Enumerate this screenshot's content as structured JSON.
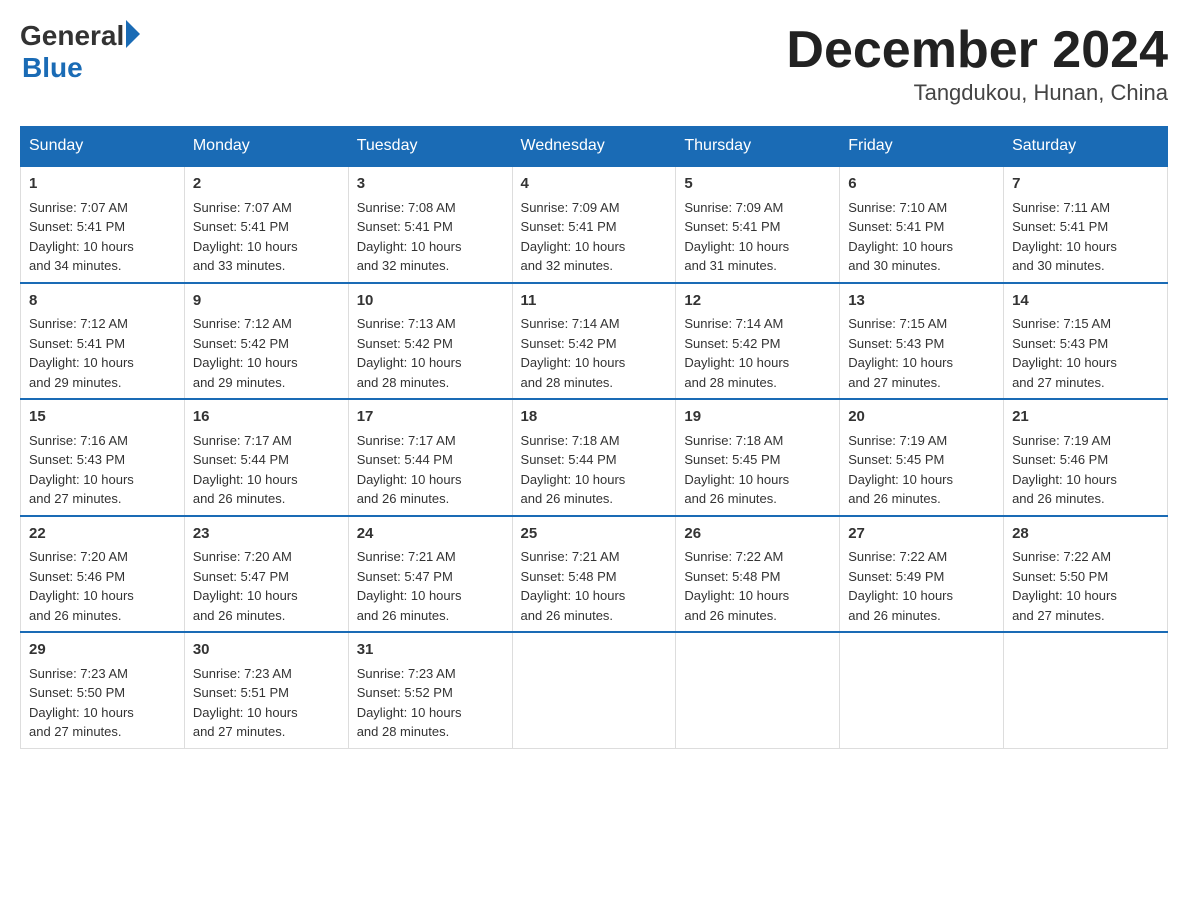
{
  "header": {
    "logo_general": "General",
    "logo_blue": "Blue",
    "month_title": "December 2024",
    "subtitle": "Tangdukou, Hunan, China"
  },
  "days_of_week": [
    "Sunday",
    "Monday",
    "Tuesday",
    "Wednesday",
    "Thursday",
    "Friday",
    "Saturday"
  ],
  "weeks": [
    [
      {
        "num": "1",
        "sunrise": "7:07 AM",
        "sunset": "5:41 PM",
        "daylight": "10 hours and 34 minutes."
      },
      {
        "num": "2",
        "sunrise": "7:07 AM",
        "sunset": "5:41 PM",
        "daylight": "10 hours and 33 minutes."
      },
      {
        "num": "3",
        "sunrise": "7:08 AM",
        "sunset": "5:41 PM",
        "daylight": "10 hours and 32 minutes."
      },
      {
        "num": "4",
        "sunrise": "7:09 AM",
        "sunset": "5:41 PM",
        "daylight": "10 hours and 32 minutes."
      },
      {
        "num": "5",
        "sunrise": "7:09 AM",
        "sunset": "5:41 PM",
        "daylight": "10 hours and 31 minutes."
      },
      {
        "num": "6",
        "sunrise": "7:10 AM",
        "sunset": "5:41 PM",
        "daylight": "10 hours and 30 minutes."
      },
      {
        "num": "7",
        "sunrise": "7:11 AM",
        "sunset": "5:41 PM",
        "daylight": "10 hours and 30 minutes."
      }
    ],
    [
      {
        "num": "8",
        "sunrise": "7:12 AM",
        "sunset": "5:41 PM",
        "daylight": "10 hours and 29 minutes."
      },
      {
        "num": "9",
        "sunrise": "7:12 AM",
        "sunset": "5:42 PM",
        "daylight": "10 hours and 29 minutes."
      },
      {
        "num": "10",
        "sunrise": "7:13 AM",
        "sunset": "5:42 PM",
        "daylight": "10 hours and 28 minutes."
      },
      {
        "num": "11",
        "sunrise": "7:14 AM",
        "sunset": "5:42 PM",
        "daylight": "10 hours and 28 minutes."
      },
      {
        "num": "12",
        "sunrise": "7:14 AM",
        "sunset": "5:42 PM",
        "daylight": "10 hours and 28 minutes."
      },
      {
        "num": "13",
        "sunrise": "7:15 AM",
        "sunset": "5:43 PM",
        "daylight": "10 hours and 27 minutes."
      },
      {
        "num": "14",
        "sunrise": "7:15 AM",
        "sunset": "5:43 PM",
        "daylight": "10 hours and 27 minutes."
      }
    ],
    [
      {
        "num": "15",
        "sunrise": "7:16 AM",
        "sunset": "5:43 PM",
        "daylight": "10 hours and 27 minutes."
      },
      {
        "num": "16",
        "sunrise": "7:17 AM",
        "sunset": "5:44 PM",
        "daylight": "10 hours and 26 minutes."
      },
      {
        "num": "17",
        "sunrise": "7:17 AM",
        "sunset": "5:44 PM",
        "daylight": "10 hours and 26 minutes."
      },
      {
        "num": "18",
        "sunrise": "7:18 AM",
        "sunset": "5:44 PM",
        "daylight": "10 hours and 26 minutes."
      },
      {
        "num": "19",
        "sunrise": "7:18 AM",
        "sunset": "5:45 PM",
        "daylight": "10 hours and 26 minutes."
      },
      {
        "num": "20",
        "sunrise": "7:19 AM",
        "sunset": "5:45 PM",
        "daylight": "10 hours and 26 minutes."
      },
      {
        "num": "21",
        "sunrise": "7:19 AM",
        "sunset": "5:46 PM",
        "daylight": "10 hours and 26 minutes."
      }
    ],
    [
      {
        "num": "22",
        "sunrise": "7:20 AM",
        "sunset": "5:46 PM",
        "daylight": "10 hours and 26 minutes."
      },
      {
        "num": "23",
        "sunrise": "7:20 AM",
        "sunset": "5:47 PM",
        "daylight": "10 hours and 26 minutes."
      },
      {
        "num": "24",
        "sunrise": "7:21 AM",
        "sunset": "5:47 PM",
        "daylight": "10 hours and 26 minutes."
      },
      {
        "num": "25",
        "sunrise": "7:21 AM",
        "sunset": "5:48 PM",
        "daylight": "10 hours and 26 minutes."
      },
      {
        "num": "26",
        "sunrise": "7:22 AM",
        "sunset": "5:48 PM",
        "daylight": "10 hours and 26 minutes."
      },
      {
        "num": "27",
        "sunrise": "7:22 AM",
        "sunset": "5:49 PM",
        "daylight": "10 hours and 26 minutes."
      },
      {
        "num": "28",
        "sunrise": "7:22 AM",
        "sunset": "5:50 PM",
        "daylight": "10 hours and 27 minutes."
      }
    ],
    [
      {
        "num": "29",
        "sunrise": "7:23 AM",
        "sunset": "5:50 PM",
        "daylight": "10 hours and 27 minutes."
      },
      {
        "num": "30",
        "sunrise": "7:23 AM",
        "sunset": "5:51 PM",
        "daylight": "10 hours and 27 minutes."
      },
      {
        "num": "31",
        "sunrise": "7:23 AM",
        "sunset": "5:52 PM",
        "daylight": "10 hours and 28 minutes."
      },
      null,
      null,
      null,
      null
    ]
  ],
  "labels": {
    "sunrise": "Sunrise:",
    "sunset": "Sunset:",
    "daylight": "Daylight:"
  }
}
